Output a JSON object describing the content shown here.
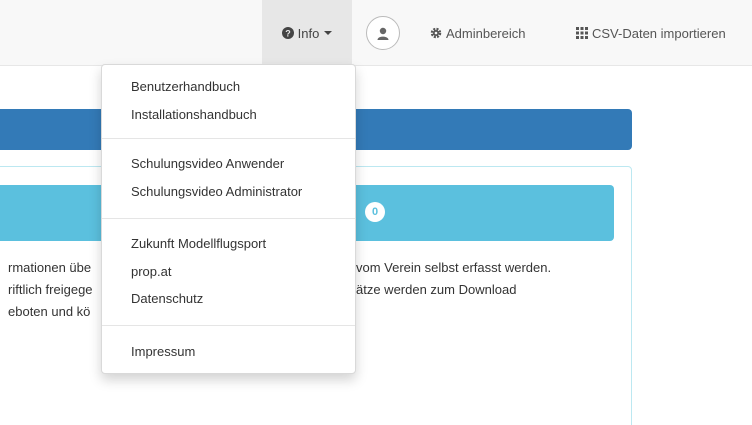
{
  "navbar": {
    "info_label": "Info",
    "admin_label": "Adminbereich",
    "csv_label": "CSV-Daten importieren",
    "icons": {
      "info": "question-circle-icon",
      "user": "user-icon",
      "admin": "cog-icon",
      "csv": "grid-icon"
    }
  },
  "badge": {
    "count": "0"
  },
  "paragraph": {
    "left": [
      "rmationen übe",
      "riftlich freigege",
      "eboten und kö"
    ],
    "right": [
      "vom Verein selbst erfasst werden.",
      "ätze werden zum Download"
    ]
  },
  "dropdown": {
    "items": [
      "Benutzerhandbuch",
      "Installationshandbuch",
      "Schulungsvideo Anwender",
      "Schulungsvideo Administrator",
      "Zukunft Modellflugsport",
      "prop.at",
      "Datenschutz",
      "Impressum"
    ]
  },
  "colors": {
    "primary": "#337ab7",
    "info": "#5bc0de",
    "navbar": "#f8f8f8"
  }
}
